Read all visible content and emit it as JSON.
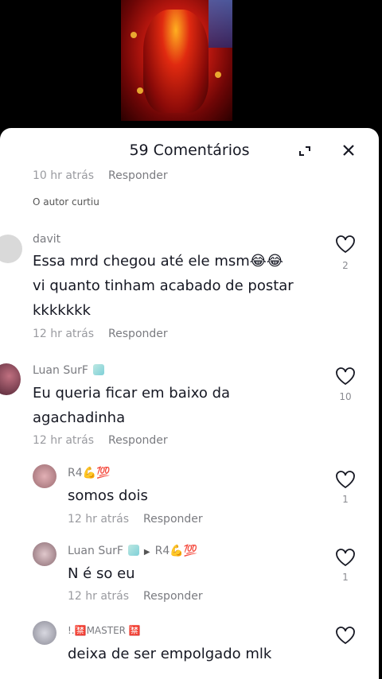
{
  "header": {
    "title": "59 Comentários"
  },
  "top_meta": {
    "time": "10 hr atrás",
    "reply": "Responder",
    "author_liked": "O autor curtiu"
  },
  "comments": [
    {
      "user": "davit",
      "text_lines": [
        "Essa mrd chegou até ele msm😂😂",
        "vi quanto tinham acabado de postar",
        "kkkkkkk"
      ],
      "time": "12 hr atrás",
      "reply": "Responder",
      "likes": "2"
    },
    {
      "user": "Luan SurF",
      "text_lines": [
        "Eu queria ficar em baixo da",
        "agachadinha"
      ],
      "time": "12 hr atrás",
      "reply": "Responder",
      "likes": "10"
    }
  ],
  "replies": [
    {
      "user": "R4💪💯",
      "text": "somos dois",
      "time": "12 hr atrás",
      "reply": "Responder",
      "likes": "1"
    },
    {
      "user": "Luan SurF",
      "reply_to": "R4💪💯",
      "text": "N é so eu",
      "time": "12 hr atrás",
      "reply": "Responder",
      "likes": "1"
    },
    {
      "user": "!.🈲MASTER 🈲",
      "text": "deixa de ser empolgado mlk"
    }
  ]
}
